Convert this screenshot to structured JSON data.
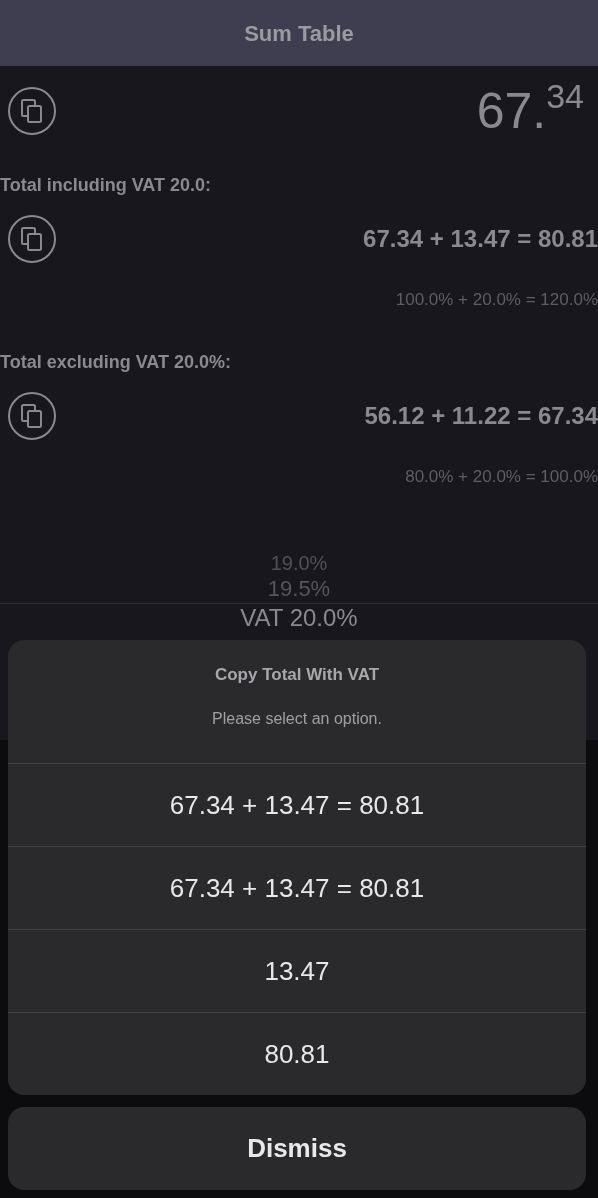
{
  "header": {
    "title": "Sum Table"
  },
  "total": {
    "value": "67.$^{34}$"
  },
  "sections": [
    {
      "label": "Total including VAT 20.0:",
      "formula": "67.34 + 13.47 = 80.81",
      "percent": "100.0% + 20.0% = 120.0%"
    },
    {
      "label": "Total excluding VAT 20.0%:",
      "formula": "56.12 + 11.22 = 67.34",
      "percent": "80.0% + 20.0% = 100.0%"
    }
  ],
  "picker": [
    {
      "label": "19.0%",
      "selected": false
    },
    {
      "label": "19.5%",
      "selected": false
    },
    {
      "label": "VAT 20.0%",
      "selected": true
    }
  ],
  "action_sheet": {
    "title": "Copy Total With VAT",
    "message": "Please select an option.",
    "options": [
      "67.34 + 13.47 = 80.81",
      "67.34 + 13.47 = 80.81",
      "13.47",
      "80.81"
    ],
    "cancel": "Dismiss"
  }
}
